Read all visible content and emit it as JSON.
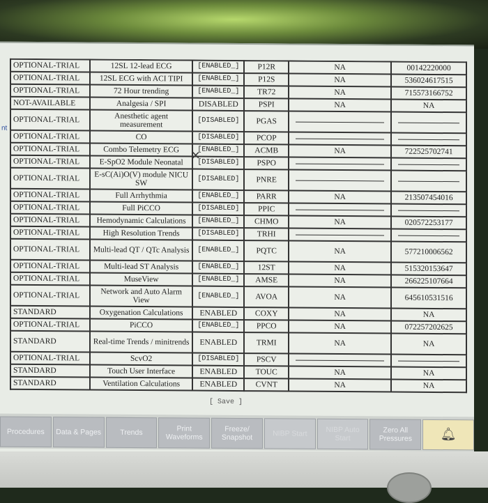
{
  "side_label": "nt",
  "rows": [
    {
      "lic": "OPTIONAL-TRIAL",
      "feat": "12SL 12-lead ECG",
      "stat": "[ENABLED_]",
      "code": "P12R",
      "val": "NA",
      "key": "00142220000"
    },
    {
      "lic": "OPTIONAL-TRIAL",
      "feat": "12SL ECG with ACI TIPI",
      "stat": "[ENABLED_]",
      "code": "P12S",
      "val": "NA",
      "key": "536024617515"
    },
    {
      "lic": "OPTIONAL-TRIAL",
      "feat": "72 Hour trending",
      "stat": "[ENABLED_]",
      "code": "TR72",
      "val": "NA",
      "key": "715573166752"
    },
    {
      "lic": "NOT-AVAILABLE",
      "feat": "Analgesia / SPI",
      "stat": "DISABLED",
      "code": "PSPI",
      "val": "NA",
      "key": "NA"
    },
    {
      "lic": "OPTIONAL-TRIAL",
      "feat": "Anesthetic agent measurement",
      "stat": "[DISABLED]",
      "code": "PGAS",
      "val": "",
      "key": ""
    },
    {
      "lic": "OPTIONAL-TRIAL",
      "feat": "CO",
      "stat": "[DISABLED]",
      "code": "PCOP",
      "val": "",
      "key": ""
    },
    {
      "lic": "OPTIONAL-TRIAL",
      "feat": "Combo Telemetry ECG",
      "stat": "[ENABLED_]",
      "code": "ACMB",
      "val": "NA",
      "key": "722525702741"
    },
    {
      "lic": "OPTIONAL-TRIAL",
      "feat": "E-SpO2 Module Neonatal",
      "stat": "[DISABLED]",
      "code": "PSPO",
      "val": "",
      "key": ""
    },
    {
      "lic": "OPTIONAL-TRIAL",
      "feat": "E-sC(Ai)O(V) module NICU SW",
      "stat": "[DISABLED]",
      "code": "PNRE",
      "val": "",
      "key": ""
    },
    {
      "lic": "OPTIONAL-TRIAL",
      "feat": "Full Arrhythmia",
      "stat": "[ENABLED_]",
      "code": "PARR",
      "val": "NA",
      "key": "213507454016"
    },
    {
      "lic": "OPTIONAL-TRIAL",
      "feat": "Full PiCCO",
      "stat": "[DISABLED]",
      "code": "PPIC",
      "val": "",
      "key": ""
    },
    {
      "lic": "OPTIONAL-TRIAL",
      "feat": "Hemodynamic Calculations",
      "stat": "[ENABLED_]",
      "code": "CHMO",
      "val": "NA",
      "key": "020572253177"
    },
    {
      "lic": "OPTIONAL-TRIAL",
      "feat": "High Resolution Trends",
      "stat": "[DISABLED]",
      "code": "TRHI",
      "val": "",
      "key": ""
    },
    {
      "lic": "OPTIONAL-TRIAL",
      "feat": "Multi-lead QT / QTc Analysis",
      "stat": "[ENABLED_]",
      "code": "PQTC",
      "val": "NA",
      "key": "577210006562"
    },
    {
      "lic": "OPTIONAL-TRIAL",
      "feat": "Multi-lead ST Analysis",
      "stat": "[ENABLED_]",
      "code": "12ST",
      "val": "NA",
      "key": "515320153647"
    },
    {
      "lic": "OPTIONAL-TRIAL",
      "feat": "MuseView",
      "stat": "[ENABLED_]",
      "code": "AMSE",
      "val": "NA",
      "key": "266225107664"
    },
    {
      "lic": "OPTIONAL-TRIAL",
      "feat": "Network and Auto Alarm View",
      "stat": "[ENABLED_]",
      "code": "AVOA",
      "val": "NA",
      "key": "645610531516"
    },
    {
      "lic": "STANDARD",
      "feat": "Oxygenation Calculations",
      "stat": "ENABLED",
      "code": "COXY",
      "val": "NA",
      "key": "NA"
    },
    {
      "lic": "OPTIONAL-TRIAL",
      "feat": "PiCCO",
      "stat": "[ENABLED_]",
      "code": "PPCO",
      "val": "NA",
      "key": "072257202625"
    },
    {
      "lic": "STANDARD",
      "feat": "Real-time Trends / minitrends",
      "stat": "ENABLED",
      "code": "TRMI",
      "val": "NA",
      "key": "NA"
    },
    {
      "lic": "OPTIONAL-TRIAL",
      "feat": "ScvO2",
      "stat": "[DISABLED]",
      "code": "PSCV",
      "val": "",
      "key": ""
    },
    {
      "lic": "STANDARD",
      "feat": "Touch User Interface",
      "stat": "ENABLED",
      "code": "TOUC",
      "val": "NA",
      "key": "NA"
    },
    {
      "lic": "STANDARD",
      "feat": "Ventilation Calculations",
      "stat": "ENABLED",
      "code": "CVNT",
      "val": "NA",
      "key": "NA"
    }
  ],
  "save_label": "[ Save ]",
  "softkeys": [
    {
      "label": "Procedures",
      "dim": false
    },
    {
      "label": "Data & Pages",
      "dim": false
    },
    {
      "label": "Trends",
      "dim": false
    },
    {
      "label": "Print Waveforms",
      "dim": false
    },
    {
      "label": "Freeze/ Snapshot",
      "dim": false
    },
    {
      "label": "NIBP Start",
      "dim": true
    },
    {
      "label": "NIBP Auto Start",
      "dim": true
    },
    {
      "label": "Zero All Pressures",
      "dim": false
    },
    {
      "label": "bell-icon",
      "dim": false,
      "alarm": true
    }
  ]
}
